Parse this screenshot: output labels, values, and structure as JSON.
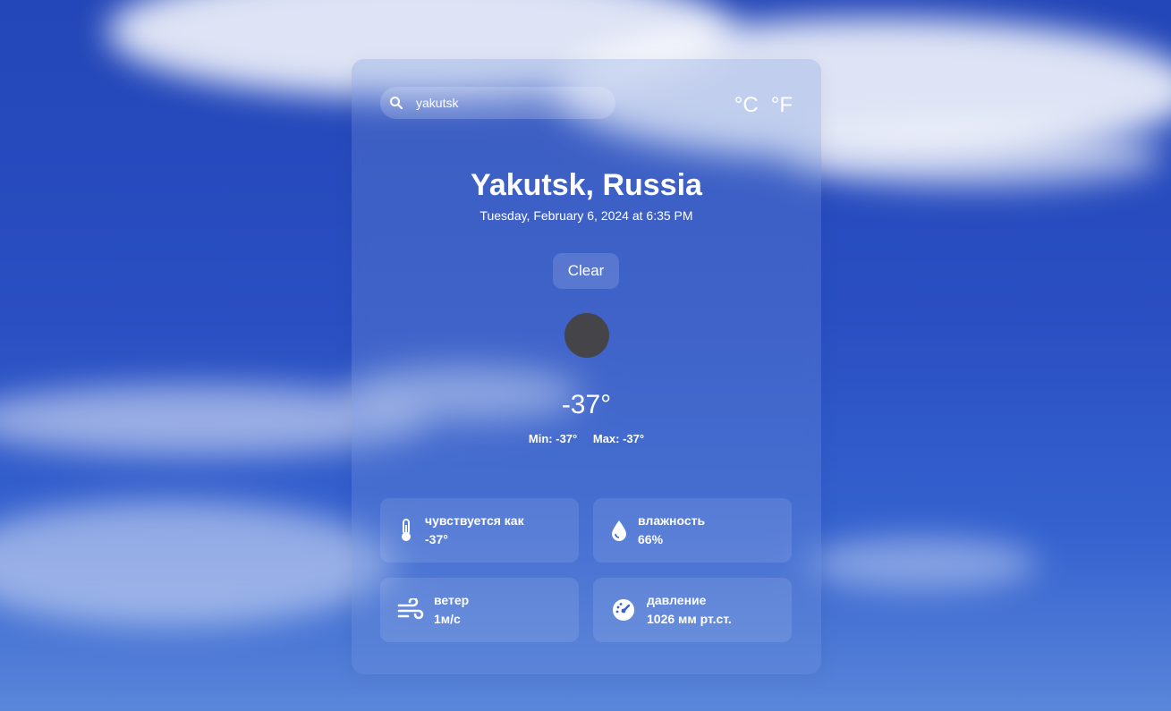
{
  "search": {
    "value": "yakutsk",
    "icon": "search-icon"
  },
  "units": {
    "celsius": "°C",
    "fahrenheit": "°F"
  },
  "location": {
    "city": "Yakutsk, Russia",
    "datetime": "Tuesday, February 6, 2024 at 6:35 PM"
  },
  "weather": {
    "condition": "Clear",
    "icon": "weather-condition-icon",
    "temperature": "-37°",
    "min": "Min: -37°",
    "max": "Max: -37°"
  },
  "details": {
    "feels_like": {
      "label": "чувствуется как",
      "value": "-37°",
      "icon": "thermometer-icon"
    },
    "humidity": {
      "label": "влажность",
      "value": "66%",
      "icon": "droplet-icon"
    },
    "wind": {
      "label": "ветер",
      "value": "1м/с",
      "icon": "wind-icon"
    },
    "pressure": {
      "label": "давление",
      "value": "1026 мм рт.ст.",
      "icon": "gauge-icon"
    }
  },
  "colors": {
    "sky": "#2a4fc2",
    "icon_circle": "#454449"
  }
}
